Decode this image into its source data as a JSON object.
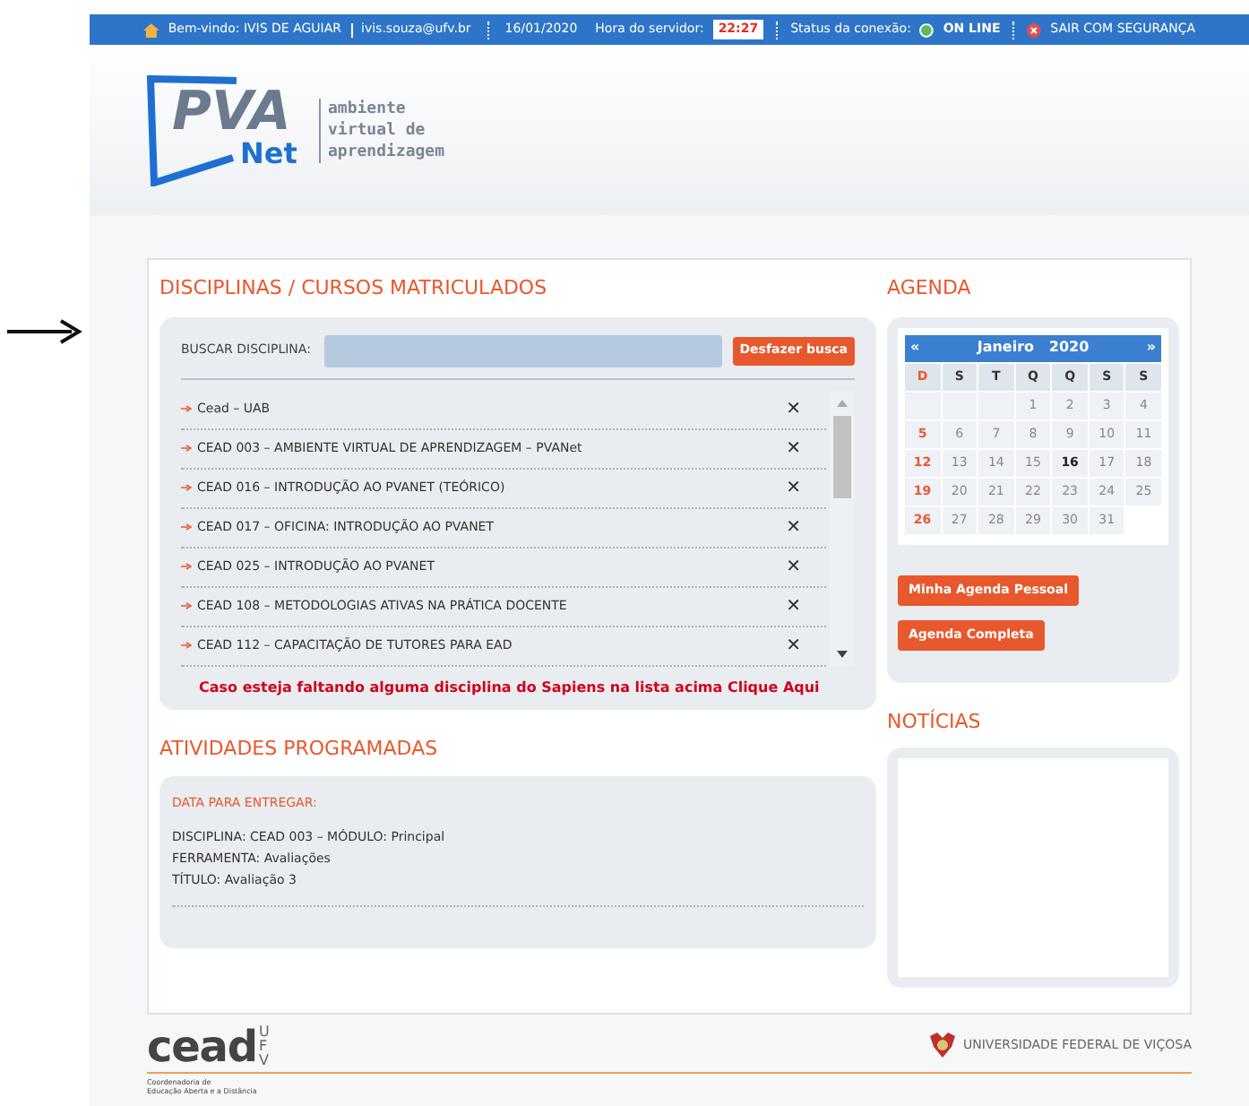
{
  "top_bar": {
    "welcome": "Bem-vindo: IVIS DE AGUIAR",
    "email": "ivis.souza@ufv.br",
    "date": "16/01/2020",
    "server_time_label": "Hora do servidor:",
    "server_time": "22:27",
    "status_label": "Status da conexão:",
    "status": "ON LINE",
    "logout": "SAIR COM SEGURANÇA"
  },
  "logo": {
    "mark": "PVA",
    "sub": "Net",
    "tagline": [
      "ambiente",
      "virtual de",
      "aprendizagem"
    ]
  },
  "courses": {
    "title": "DISCIPLINAS / CURSOS MATRICULADOS",
    "search_label": "BUSCAR DISCIPLINA:",
    "undo_button": "Desfazer busca",
    "items": [
      {
        "name": "Cead – UAB",
        "remove": "✕"
      },
      {
        "name": "CEAD 003 – AMBIENTE VIRTUAL DE APRENDIZAGEM – PVANet",
        "remove": "✕"
      },
      {
        "name": "CEAD 016 – INTRODUÇÃO AO PVANET (TEÓRICO)",
        "remove": "✕"
      },
      {
        "name": "CEAD 017 – OFICINA: INTRODUÇÃO AO PVANET",
        "remove": "✕"
      },
      {
        "name": "CEAD 025 – INTRODUÇÃO AO PVANET",
        "remove": "✕"
      },
      {
        "name": "CEAD 108 – METODOLOGIAS ATIVAS NA PRÁTICA DOCENTE",
        "remove": "✕"
      },
      {
        "name": "CEAD 112 – CAPACITAÇÃO DE TUTORES PARA EAD",
        "remove": "✕"
      }
    ],
    "missing_notice": "Caso esteja faltando alguma disciplina do Sapiens na lista acima Clique Aqui"
  },
  "activities": {
    "title": "ATIVIDADES PROGRAMADAS",
    "due_label": "DATA PARA ENTREGAR:",
    "lines": [
      "DISCIPLINA: CEAD 003 – MÓDULO: Principal",
      "FERRAMENTA: Avaliações",
      "TÍTULO: Avaliação 3"
    ]
  },
  "agenda": {
    "title": "AGENDA",
    "prev": "«",
    "next": "»",
    "month": "Janeiro",
    "year": "2020",
    "weekdays": [
      "D",
      "S",
      "T",
      "Q",
      "Q",
      "S",
      "S"
    ],
    "weeks": [
      [
        {
          "kind": "empty"
        },
        {
          "kind": "empty"
        },
        {
          "kind": "empty"
        },
        {
          "day": "1",
          "today": false
        },
        {
          "day": "2",
          "today": false
        },
        {
          "day": "3",
          "today": false
        },
        {
          "day": "4",
          "today": false
        }
      ],
      [
        {
          "day": "5",
          "today": false
        },
        {
          "day": "6",
          "today": false
        },
        {
          "day": "7",
          "today": false
        },
        {
          "day": "8",
          "today": false
        },
        {
          "day": "9",
          "today": false
        },
        {
          "day": "10",
          "today": false
        },
        {
          "day": "11",
          "today": false
        }
      ],
      [
        {
          "day": "12",
          "today": false
        },
        {
          "day": "13",
          "today": false
        },
        {
          "day": "14",
          "today": false
        },
        {
          "day": "15",
          "today": false
        },
        {
          "day": "16",
          "today": true
        },
        {
          "day": "17",
          "today": false
        },
        {
          "day": "18",
          "today": false
        }
      ],
      [
        {
          "day": "19",
          "today": false
        },
        {
          "day": "20",
          "today": false
        },
        {
          "day": "21",
          "today": false
        },
        {
          "day": "22",
          "today": false
        },
        {
          "day": "23",
          "today": false
        },
        {
          "day": "24",
          "today": false
        },
        {
          "day": "25",
          "today": false
        }
      ],
      [
        {
          "day": "26",
          "today": false
        },
        {
          "day": "27",
          "today": false
        },
        {
          "day": "28",
          "today": false
        },
        {
          "day": "29",
          "today": false
        },
        {
          "day": "30",
          "today": false
        },
        {
          "day": "31",
          "today": false
        },
        {
          "kind": "empty"
        }
      ]
    ],
    "buttons": [
      "Minha Agenda Pessoal",
      "Agenda Completa"
    ]
  },
  "news": {
    "title": "NOTÍCIAS"
  },
  "footer": {
    "cead_logo": "cead",
    "cead_ufv": "UFV",
    "cead_caption": [
      "Coordenadoria de",
      "Educação Aberta e a Distância"
    ],
    "university": "UNIVERSIDADE FEDERAL DE VIÇOSA"
  }
}
